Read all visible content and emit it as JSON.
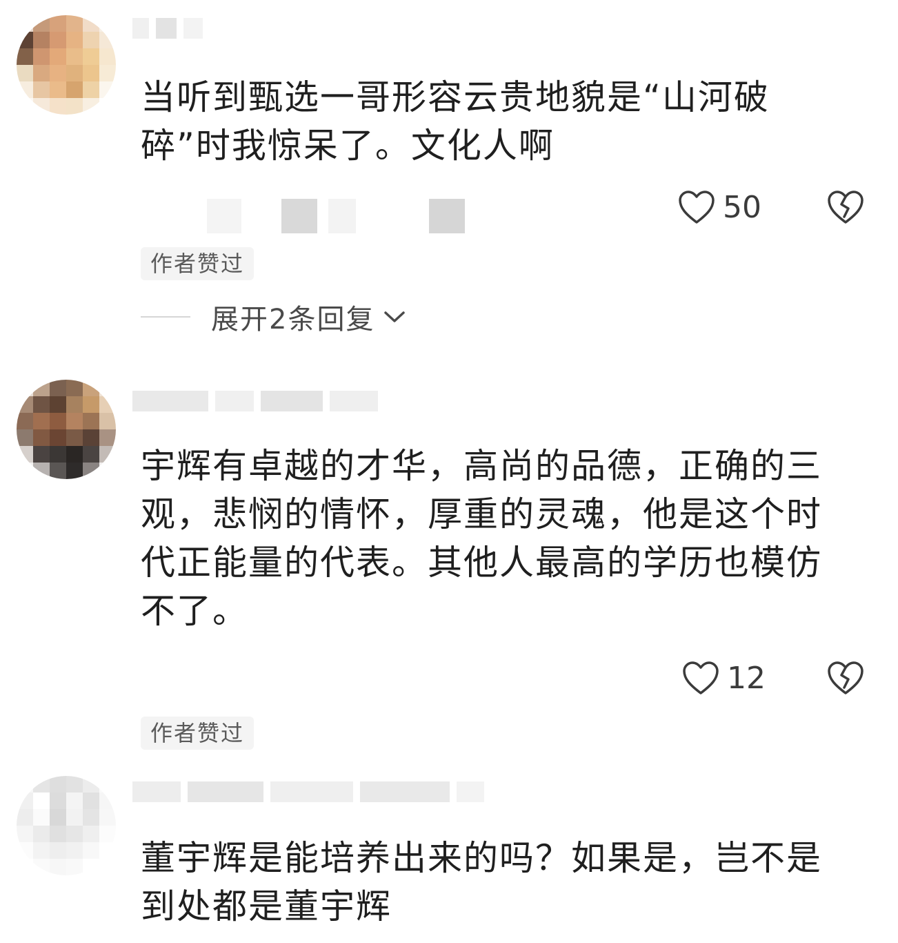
{
  "comments": [
    {
      "text": "当听到甄选一哥形容云贵地貌是“山河破碎”时我惊呆了。文化人啊",
      "like_count": "50",
      "badge": "作者赞过",
      "replies_label": "展开2条回复"
    },
    {
      "text": "宇辉有卓越的才华，高尚的品德，正确的三观，悲悯的情怀，厚重的灵魂，他是这个时代正能量的代表。其他人最高的学历也模仿不了。",
      "like_count": "12",
      "badge": "作者赞过"
    },
    {
      "text": "董宇辉是能培养出来的吗？如果是，岂不是到处都是董宇辉"
    }
  ],
  "icons": {
    "like": "heart-outline-icon",
    "dislike": "broken-heart-icon",
    "expand": "chevron-down-icon"
  },
  "colors": {
    "text": "#1f1f1f",
    "secondary": "#5a5a5a",
    "badge_bg": "#f4f4f4"
  }
}
